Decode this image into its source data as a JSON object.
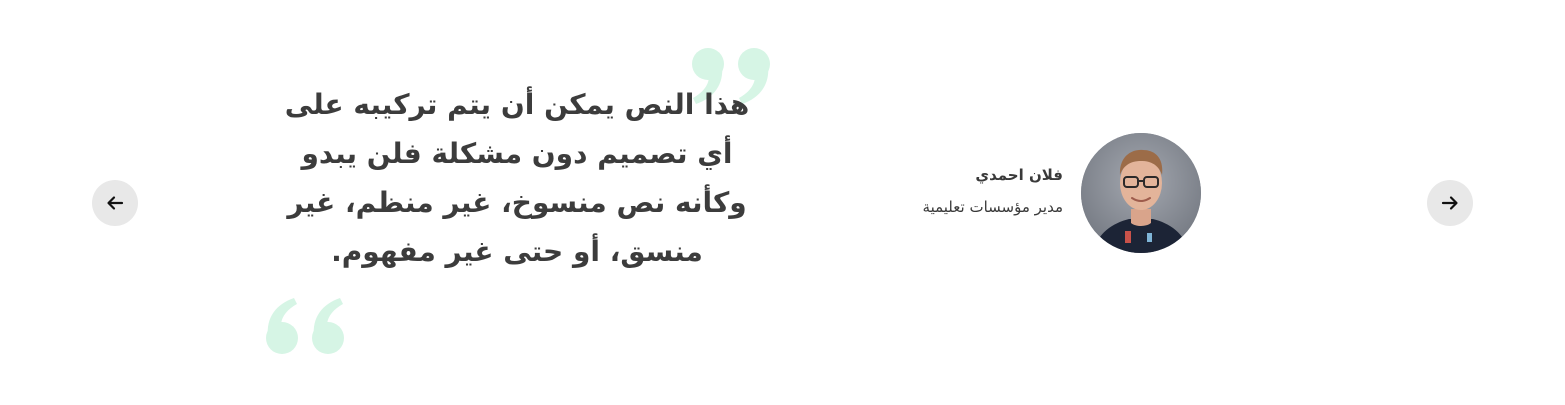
{
  "testimonial": {
    "quote": "هذا النص يمكن أن يتم تركيبه على أي تصميم دون مشكلة فلن يبدو وكأنه نص منسوخ، غير منظم، غير منسق، أو حتى غير مفهوم.",
    "author_name": "فلان احمدي",
    "author_role": "مدير مؤسسات تعليمية"
  },
  "icons": {
    "prev": "arrow-left-icon",
    "next": "arrow-right-icon",
    "quote_open": "opening-quote-icon",
    "quote_close": "closing-quote-icon"
  },
  "colors": {
    "accent_quote": "#d6f5e5",
    "nav_button_bg": "#e8e8e8",
    "text": "#3c3c3c"
  }
}
